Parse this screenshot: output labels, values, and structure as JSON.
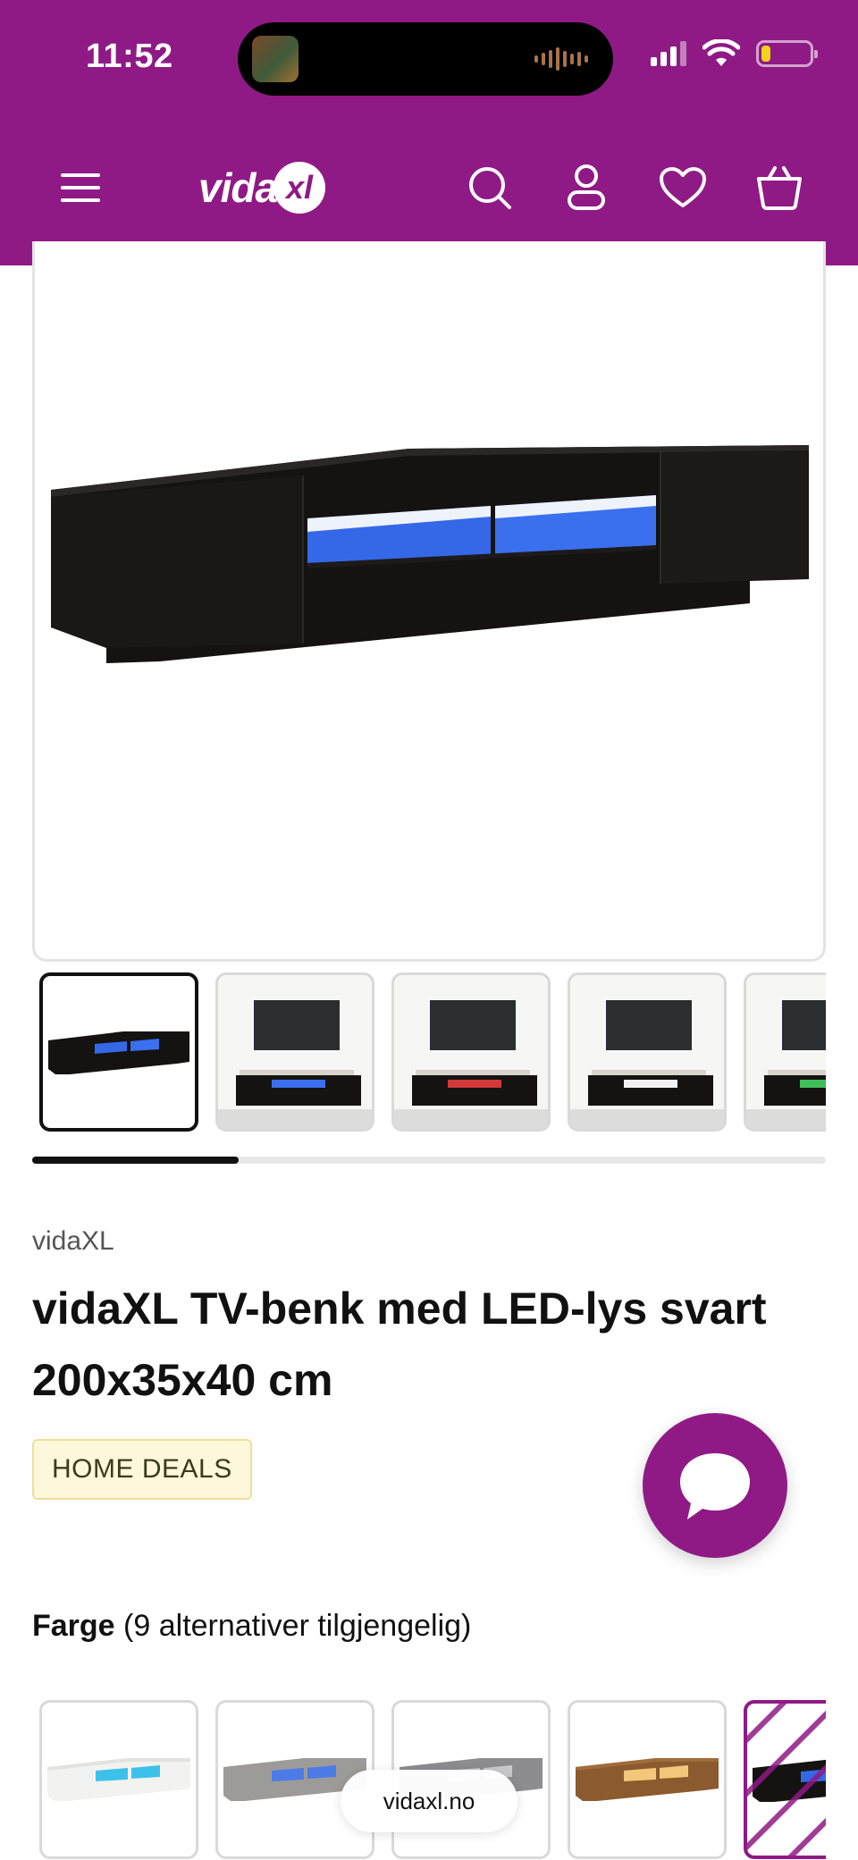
{
  "colors": {
    "brand": "#8f1a86",
    "battery": "#f2d21b"
  },
  "status_bar": {
    "time": "11:52",
    "battery_level": 0.2
  },
  "header": {
    "logo": "vidaXL",
    "icons": [
      "menu-icon",
      "search-icon",
      "account-icon",
      "heart-icon",
      "basket-icon"
    ]
  },
  "gallery": {
    "thumbnail_count": 5,
    "active_thumbnail": 0,
    "scroll_progress": 0.26
  },
  "product": {
    "brand": "vidaXL",
    "title": "vidaXL TV-benk med LED-lys svart 200x35x40 cm",
    "badge": "HOME DEALS"
  },
  "color_selector": {
    "label": "Farge",
    "count_text": "(9 alternativer tilgjengelig)",
    "swatches": [
      "white",
      "concrete grey",
      "grey",
      "smoked oak",
      "black"
    ],
    "selected_index": 4
  },
  "browser": {
    "url": "vidaxl.no"
  }
}
